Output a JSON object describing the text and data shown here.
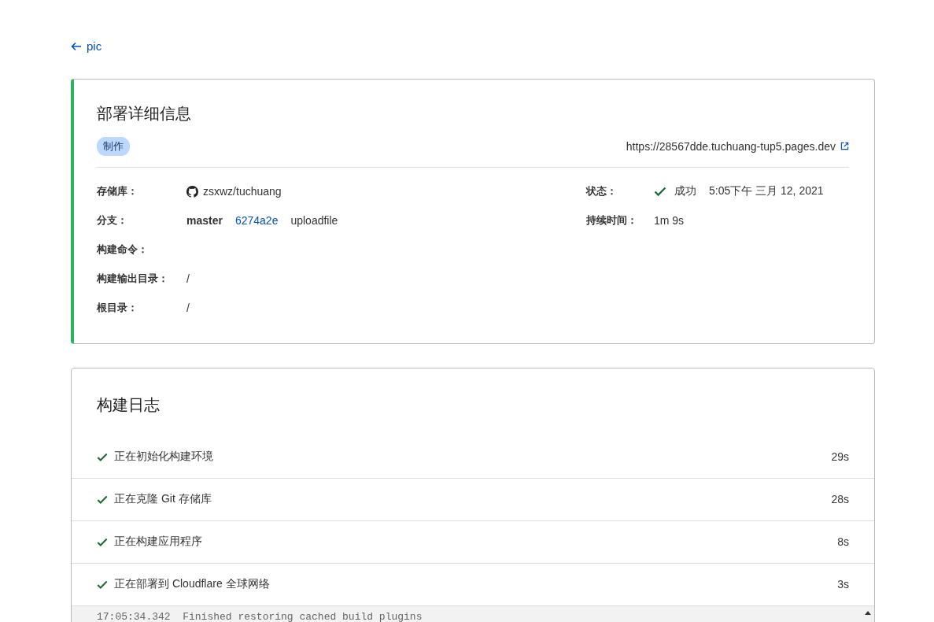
{
  "back_link": {
    "label": "pic"
  },
  "deployment": {
    "title": "部署详细信息",
    "environment_badge": "制作",
    "url": "https://28567dde.tuchuang-tup5.pages.dev",
    "left_fields": [
      {
        "label": "存储库：",
        "kind": "repo",
        "value": "zsxwz/tuchuang"
      },
      {
        "label": "分支：",
        "kind": "branch",
        "branch": "master",
        "commit": "6274a2e",
        "message": "uploadfile"
      },
      {
        "label": "构建命令：",
        "kind": "text"
      },
      {
        "label": "构建输出目录：",
        "kind": "text",
        "value": "/"
      },
      {
        "label": "根目录：",
        "kind": "text",
        "value": "/"
      }
    ],
    "right_fields": [
      {
        "label": "状态：",
        "kind": "status",
        "success": true,
        "status": "成功",
        "time": "5:05下午 三月 12, 2021"
      },
      {
        "label": "持续时间：",
        "kind": "text",
        "value": "1m 9s"
      }
    ]
  },
  "build_log": {
    "title": "构建日志",
    "steps": [
      {
        "label": "正在初始化构建环境",
        "done": true,
        "duration": "29s"
      },
      {
        "label": "正在克隆 Git 存储库",
        "done": true,
        "duration": "28s"
      },
      {
        "label": "正在构建应用程序",
        "done": true,
        "duration": "8s"
      },
      {
        "label": "正在部署到 Cloudflare 全球网络",
        "done": true,
        "duration": "3s"
      }
    ],
    "log_lines": [
      "17:05:34.342  Finished restoring cached build plugins"
    ]
  }
}
